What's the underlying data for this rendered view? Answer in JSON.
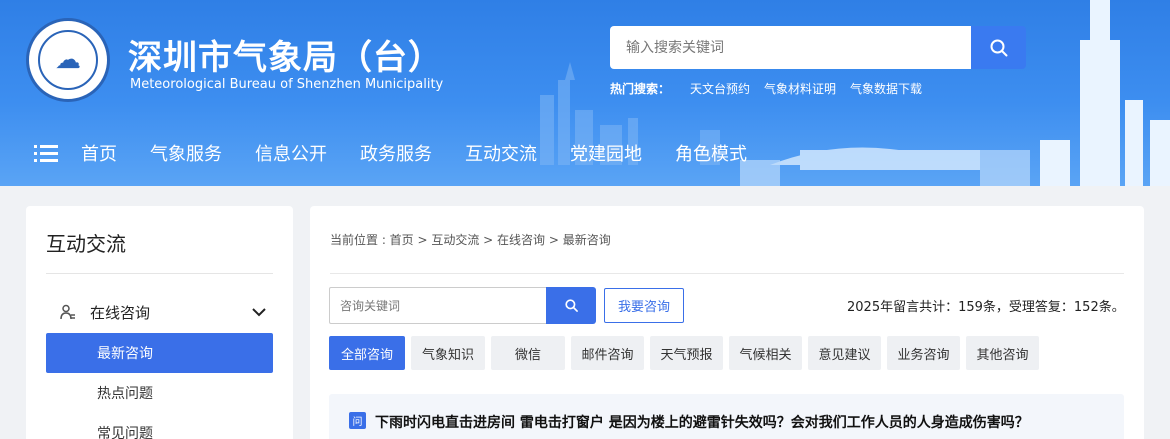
{
  "header": {
    "logo_text": "深圳市气象局",
    "title": "深圳市气象局（台）",
    "subtitle": "Meteorological Bureau of Shenzhen Municipality",
    "search": {
      "placeholder": "输入搜索关键词"
    },
    "hot_search": {
      "label": "热门搜索：",
      "items": [
        "天文台预约",
        "气象材料证明",
        "气象数据下载"
      ]
    }
  },
  "nav": {
    "items": [
      "首页",
      "气象服务",
      "信息公开",
      "政务服务",
      "互动交流",
      "党建园地",
      "角色模式"
    ]
  },
  "sidebar": {
    "title": "互动交流",
    "group": {
      "label": "在线咨询",
      "expanded": true
    },
    "sub_items": [
      {
        "label": "最新咨询",
        "active": true
      },
      {
        "label": "热点问题",
        "active": false
      },
      {
        "label": "常见问题",
        "active": false
      }
    ]
  },
  "main": {
    "breadcrumb": "当前位置 : 首页 > 互动交流 > 在线咨询 > 最新咨询",
    "search": {
      "placeholder": "咨询关键词"
    },
    "ask_button": "我要咨询",
    "stats": "2025年留言共计：159条，受理答复：152条。",
    "tabs": [
      {
        "label": "全部咨询",
        "active": true
      },
      {
        "label": "气象知识",
        "active": false
      },
      {
        "label": "微信",
        "active": false
      },
      {
        "label": "邮件咨询",
        "active": false
      },
      {
        "label": "天气预报",
        "active": false
      },
      {
        "label": "气候相关",
        "active": false
      },
      {
        "label": "意见建议",
        "active": false
      },
      {
        "label": "业务咨询",
        "active": false
      },
      {
        "label": "其他咨询",
        "active": false
      }
    ],
    "questions": [
      {
        "badge": "问",
        "text": "下雨时闪电直击进房间 雷电击打窗户 是因为楼上的避雷针失效吗？会对我们工作人员的人身造成伤害吗？"
      }
    ]
  },
  "colors": {
    "header_blue": "#3d8ef0",
    "accent": "#3a6fe8",
    "tab_bg": "#eef0f3"
  }
}
